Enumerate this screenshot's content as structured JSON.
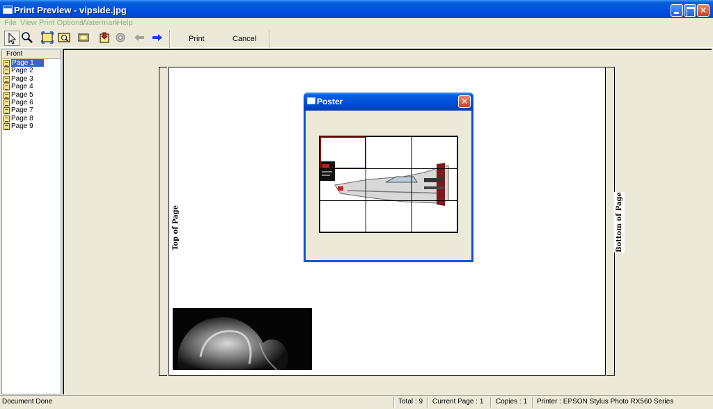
{
  "window": {
    "title": "Print Preview - vipside.jpg"
  },
  "menu": [
    "File",
    "View",
    "Print Options",
    "Watermark",
    "Help"
  ],
  "toolbar": {
    "print_label": "Print",
    "cancel_label": "Cancel"
  },
  "left_panel": {
    "header": "Front",
    "items": [
      "Page 1",
      "Page 2",
      "Page 3",
      "Page 4",
      "Page 5",
      "Page 6",
      "Page 7",
      "Page 8",
      "Page 9"
    ],
    "selected": "Page 1"
  },
  "preview": {
    "top_label": "Top of Page",
    "bottom_label": "Bottom of Page"
  },
  "dialog": {
    "title": "Poster"
  },
  "status": {
    "message": "Document Done",
    "total": "Total : 9",
    "current_page": "Current Page : 1",
    "copies": "Copies : 1",
    "printer": "Printer : EPSON Stylus Photo RX560 Series"
  },
  "colors": {
    "title_blue": "#0050e0",
    "selection": "#316ac5",
    "selected_cell_border": "#8b0000"
  }
}
